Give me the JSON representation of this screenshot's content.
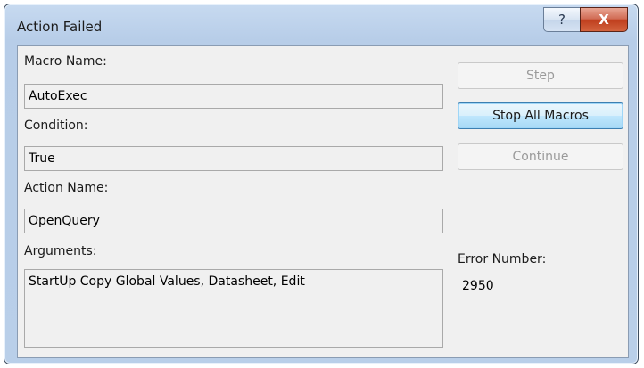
{
  "window": {
    "title": "Action Failed",
    "help_glyph": "?",
    "close_glyph": "X"
  },
  "fields": {
    "macro_name": {
      "label": "Macro Name:",
      "value": "AutoExec"
    },
    "condition": {
      "label": "Condition:",
      "value": "True"
    },
    "action_name": {
      "label": "Action Name:",
      "value": "OpenQuery"
    },
    "arguments": {
      "label": "Arguments:",
      "value": "StartUp Copy Global Values, Datasheet, Edit"
    },
    "error_number": {
      "label": "Error Number:",
      "value": "2950"
    }
  },
  "buttons": {
    "step": "Step",
    "stop_all_macros": "Stop All Macros",
    "continue": "Continue"
  },
  "colors": {
    "frame": "#b9cfe9",
    "close": "#c0401f",
    "focus_border": "#3c7fb1"
  }
}
